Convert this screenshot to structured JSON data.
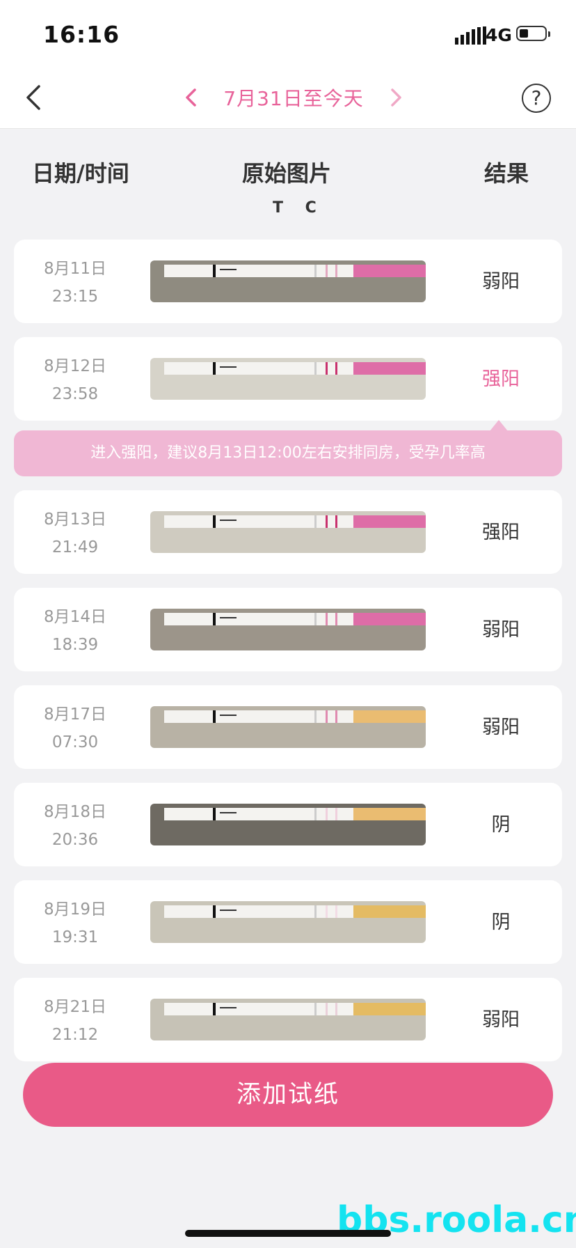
{
  "status": {
    "time": "16:16",
    "network": "4G"
  },
  "nav": {
    "date_range": "7月31日至今天",
    "help_label": "?"
  },
  "headers": {
    "date_time": "日期/时间",
    "original_image": "原始图片",
    "result": "结果",
    "tc": "T C"
  },
  "records": [
    {
      "date": "8月11日",
      "time": "23:15",
      "result": "弱阳",
      "photo_bg": "#8f8b80",
      "line_color": "#e3a8c0",
      "strip_end": "#d9559a"
    },
    {
      "date": "8月12日",
      "time": "23:58",
      "result": "强阳",
      "photo_bg": "#d6d3c9",
      "line_color": "#c8326e",
      "strip_end": "#d9559a"
    },
    {
      "date": "8月13日",
      "time": "21:49",
      "result": "强阳",
      "photo_bg": "#cfcbc0",
      "line_color": "#c8326e",
      "strip_end": "#d9559a"
    },
    {
      "date": "8月14日",
      "time": "18:39",
      "result": "弱阳",
      "photo_bg": "#9c958a",
      "line_color": "#e08ab0",
      "strip_end": "#d9559a"
    },
    {
      "date": "8月17日",
      "time": "07:30",
      "result": "弱阳",
      "photo_bg": "#b8b2a5",
      "line_color": "#e08ab0",
      "strip_end": "#e8b25a"
    },
    {
      "date": "8月18日",
      "time": "20:36",
      "result": "阴",
      "photo_bg": "#6e6a62",
      "line_color": "#f0d0dd",
      "strip_end": "#e8b25a"
    },
    {
      "date": "8月19日",
      "time": "19:31",
      "result": "阴",
      "photo_bg": "#c9c5b8",
      "line_color": "#f2dce5",
      "strip_end": "#e0b04a"
    },
    {
      "date": "8月21日",
      "time": "21:12",
      "result": "弱阳",
      "photo_bg": "#c6c2b6",
      "line_color": "#ead0da",
      "strip_end": "#e0b04a"
    }
  ],
  "tip": {
    "text": "进入强阳，建议8月13日12:00左右安排同房，受孕几率高"
  },
  "add_button": {
    "label": "添加试纸"
  },
  "watermark": "bbs.roola.cn",
  "colors": {
    "accent": "#e8639a",
    "button": "#e95a87",
    "tip_bg": "#f0b7d4"
  }
}
